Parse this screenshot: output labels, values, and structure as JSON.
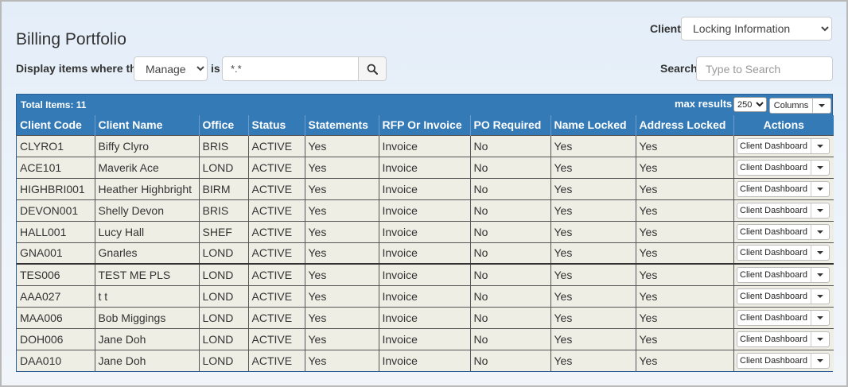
{
  "header": {
    "title": "Billing Portfolio",
    "client_label": "Client",
    "client_selected": "Locking Information"
  },
  "filter": {
    "prefix": "Display items where the",
    "field_selected": "Manager",
    "operator": "is",
    "value": "*.*",
    "search_icon": "search-icon"
  },
  "search": {
    "label": "Search",
    "placeholder": "Type to Search"
  },
  "grid": {
    "total_items": "Total Items: 11",
    "max_results_label": "max results",
    "max_results_value": "250",
    "columns_label": "Columns",
    "headers": {
      "client_code": "Client Code",
      "client_name": "Client Name",
      "office": "Office",
      "status": "Status",
      "statements": "Statements",
      "rfp": "RFP Or Invoice",
      "po": "PO Required",
      "name_locked": "Name Locked",
      "address_locked": "Address Locked",
      "actions": "Actions"
    },
    "action_label": "Client Dashboard",
    "rows": [
      {
        "code": "CLYRO1",
        "name": "Biffy Clyro",
        "office": "BRIS",
        "status": "ACTIVE",
        "statements": "Yes",
        "rfp": "Invoice",
        "po": "No",
        "name_locked": "Yes",
        "address_locked": "Yes"
      },
      {
        "code": "ACE101",
        "name": "Maverik Ace",
        "office": "LOND",
        "status": "ACTIVE",
        "statements": "Yes",
        "rfp": "Invoice",
        "po": "No",
        "name_locked": "Yes",
        "address_locked": "Yes"
      },
      {
        "code": "HIGHBRI001",
        "name": "Heather Highbright",
        "office": "BIRM",
        "status": "ACTIVE",
        "statements": "Yes",
        "rfp": "Invoice",
        "po": "No",
        "name_locked": "Yes",
        "address_locked": "Yes"
      },
      {
        "code": "DEVON001",
        "name": "Shelly Devon",
        "office": "BRIS",
        "status": "ACTIVE",
        "statements": "Yes",
        "rfp": "Invoice",
        "po": "No",
        "name_locked": "Yes",
        "address_locked": "Yes"
      },
      {
        "code": "HALL001",
        "name": "Lucy Hall",
        "office": "SHEF",
        "status": "ACTIVE",
        "statements": "Yes",
        "rfp": "Invoice",
        "po": "No",
        "name_locked": "Yes",
        "address_locked": "Yes"
      },
      {
        "code": "GNA001",
        "name": "Gnarles",
        "office": "LOND",
        "status": "ACTIVE",
        "statements": "Yes",
        "rfp": "Invoice",
        "po": "No",
        "name_locked": "Yes",
        "address_locked": "Yes"
      },
      {
        "code": "TES006",
        "name": "TEST ME PLS",
        "office": "LOND",
        "status": "ACTIVE",
        "statements": "Yes",
        "rfp": "Invoice",
        "po": "No",
        "name_locked": "Yes",
        "address_locked": "Yes"
      },
      {
        "code": "AAA027",
        "name": "t t",
        "office": "LOND",
        "status": "ACTIVE",
        "statements": "Yes",
        "rfp": "Invoice",
        "po": "No",
        "name_locked": "Yes",
        "address_locked": "Yes"
      },
      {
        "code": "MAA006",
        "name": "Bob Miggings",
        "office": "LOND",
        "status": "ACTIVE",
        "statements": "Yes",
        "rfp": "Invoice",
        "po": "No",
        "name_locked": "Yes",
        "address_locked": "Yes"
      },
      {
        "code": "DOH006",
        "name": "Jane Doh",
        "office": "LOND",
        "status": "ACTIVE",
        "statements": "Yes",
        "rfp": "Invoice",
        "po": "No",
        "name_locked": "Yes",
        "address_locked": "Yes"
      },
      {
        "code": "DAA010",
        "name": "Jane Doh",
        "office": "LOND",
        "status": "ACTIVE",
        "statements": "Yes",
        "rfp": "Invoice",
        "po": "No",
        "name_locked": "Yes",
        "address_locked": "Yes"
      }
    ]
  }
}
